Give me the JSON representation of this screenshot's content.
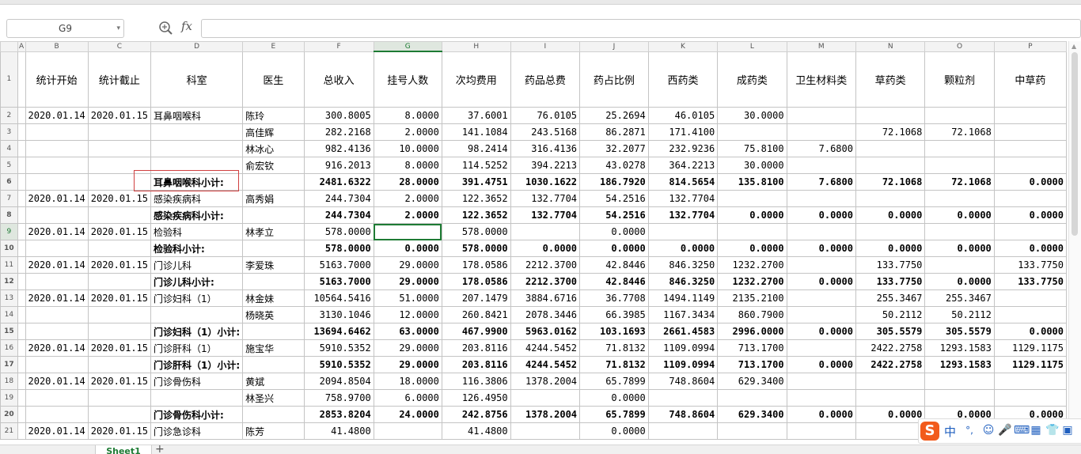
{
  "formula_bar": {
    "cell_ref": "G9",
    "fx_label": "fx",
    "formula": ""
  },
  "columns": [
    "A",
    "B",
    "C",
    "D",
    "E",
    "F",
    "G",
    "H",
    "I",
    "J",
    "K",
    "L",
    "M",
    "N",
    "O",
    "P"
  ],
  "header": [
    "统计开始",
    "统计截止",
    "科室",
    "医生",
    "总收入",
    "挂号人数",
    "次均费用",
    "药品总费",
    "药占比例",
    "西药类",
    "成药类",
    "卫生材料类",
    "草药类",
    "颗粒剂",
    "中草药"
  ],
  "rows": [
    {
      "num": "2",
      "type": "data",
      "cells": [
        "2020.01.14",
        "2020.01.15",
        "耳鼻咽喉科",
        "陈玲",
        "300.8005",
        "8.0000",
        "37.6001",
        "76.0105",
        "25.2694",
        "46.0105",
        "30.0000",
        "",
        "",
        "",
        ""
      ]
    },
    {
      "num": "3",
      "type": "data",
      "cells": [
        "",
        "",
        "",
        "高佳辉",
        "282.2168",
        "2.0000",
        "141.1084",
        "243.5168",
        "86.2871",
        "171.4100",
        "",
        "",
        "72.1068",
        "72.1068",
        ""
      ]
    },
    {
      "num": "4",
      "type": "data",
      "cells": [
        "",
        "",
        "",
        "林冰心",
        "982.4136",
        "10.0000",
        "98.2414",
        "316.4136",
        "32.2077",
        "232.9236",
        "75.8100",
        "7.6800",
        "",
        "",
        ""
      ]
    },
    {
      "num": "5",
      "type": "data",
      "cells": [
        "",
        "",
        "",
        "俞宏钦",
        "916.2013",
        "8.0000",
        "114.5252",
        "394.2213",
        "43.0278",
        "364.2213",
        "30.0000",
        "",
        "",
        "",
        ""
      ]
    },
    {
      "num": "6",
      "type": "sub",
      "cells": [
        "",
        "",
        "耳鼻咽喉科小计:",
        "",
        "2481.6322",
        "28.0000",
        "391.4751",
        "1030.1622",
        "186.7920",
        "814.5654",
        "135.8100",
        "7.6800",
        "72.1068",
        "72.1068",
        "0.0000"
      ]
    },
    {
      "num": "7",
      "type": "data",
      "cells": [
        "2020.01.14",
        "2020.01.15",
        "感染疾病科",
        "高秀娟",
        "244.7304",
        "2.0000",
        "122.3652",
        "132.7704",
        "54.2516",
        "132.7704",
        "",
        "",
        "",
        "",
        ""
      ]
    },
    {
      "num": "8",
      "type": "sub",
      "cells": [
        "",
        "",
        "感染疾病科小计:",
        "",
        "244.7304",
        "2.0000",
        "122.3652",
        "132.7704",
        "54.2516",
        "132.7704",
        "0.0000",
        "0.0000",
        "0.0000",
        "0.0000",
        "0.0000"
      ]
    },
    {
      "num": "9",
      "type": "data",
      "cells": [
        "2020.01.14",
        "2020.01.15",
        "检验科",
        "林孝立",
        "578.0000",
        "",
        "578.0000",
        "",
        "0.0000",
        "",
        "",
        "",
        "",
        "",
        ""
      ]
    },
    {
      "num": "10",
      "type": "sub",
      "cells": [
        "",
        "",
        "检验科小计:",
        "",
        "578.0000",
        "0.0000",
        "578.0000",
        "0.0000",
        "0.0000",
        "0.0000",
        "0.0000",
        "0.0000",
        "0.0000",
        "0.0000",
        "0.0000"
      ]
    },
    {
      "num": "11",
      "type": "data",
      "cells": [
        "2020.01.14",
        "2020.01.15",
        "门诊儿科",
        "李爱珠",
        "5163.7000",
        "29.0000",
        "178.0586",
        "2212.3700",
        "42.8446",
        "846.3250",
        "1232.2700",
        "",
        "133.7750",
        "",
        "133.7750"
      ]
    },
    {
      "num": "12",
      "type": "sub",
      "cells": [
        "",
        "",
        "门诊儿科小计:",
        "",
        "5163.7000",
        "29.0000",
        "178.0586",
        "2212.3700",
        "42.8446",
        "846.3250",
        "1232.2700",
        "0.0000",
        "133.7750",
        "0.0000",
        "133.7750"
      ]
    },
    {
      "num": "13",
      "type": "data",
      "cells": [
        "2020.01.14",
        "2020.01.15",
        "门诊妇科（1）",
        "林金妹",
        "10564.5416",
        "51.0000",
        "207.1479",
        "3884.6716",
        "36.7708",
        "1494.1149",
        "2135.2100",
        "",
        "255.3467",
        "255.3467",
        ""
      ]
    },
    {
      "num": "14",
      "type": "data",
      "cells": [
        "",
        "",
        "",
        "杨晓英",
        "3130.1046",
        "12.0000",
        "260.8421",
        "2078.3446",
        "66.3985",
        "1167.3434",
        "860.7900",
        "",
        "50.2112",
        "50.2112",
        ""
      ]
    },
    {
      "num": "15",
      "type": "sub",
      "cells": [
        "",
        "",
        "门诊妇科（1）小计:",
        "",
        "13694.6462",
        "63.0000",
        "467.9900",
        "5963.0162",
        "103.1693",
        "2661.4583",
        "2996.0000",
        "0.0000",
        "305.5579",
        "305.5579",
        "0.0000"
      ]
    },
    {
      "num": "16",
      "type": "data",
      "cells": [
        "2020.01.14",
        "2020.01.15",
        "门诊肝科（1）",
        "施宝华",
        "5910.5352",
        "29.0000",
        "203.8116",
        "4244.5452",
        "71.8132",
        "1109.0994",
        "713.1700",
        "",
        "2422.2758",
        "1293.1583",
        "1129.1175"
      ]
    },
    {
      "num": "17",
      "type": "sub",
      "cells": [
        "",
        "",
        "门诊肝科（1）小计:",
        "",
        "5910.5352",
        "29.0000",
        "203.8116",
        "4244.5452",
        "71.8132",
        "1109.0994",
        "713.1700",
        "0.0000",
        "2422.2758",
        "1293.1583",
        "1129.1175"
      ]
    },
    {
      "num": "18",
      "type": "data",
      "cells": [
        "2020.01.14",
        "2020.01.15",
        "门诊骨伤科",
        "黄斌",
        "2094.8504",
        "18.0000",
        "116.3806",
        "1378.2004",
        "65.7899",
        "748.8604",
        "629.3400",
        "",
        "",
        "",
        ""
      ]
    },
    {
      "num": "19",
      "type": "data",
      "cells": [
        "",
        "",
        "",
        "林圣兴",
        "758.9700",
        "6.0000",
        "126.4950",
        "",
        "0.0000",
        "",
        "",
        "",
        "",
        "",
        ""
      ]
    },
    {
      "num": "20",
      "type": "sub",
      "cells": [
        "",
        "",
        "门诊骨伤科小计:",
        "",
        "2853.8204",
        "24.0000",
        "242.8756",
        "1378.2004",
        "65.7899",
        "748.8604",
        "629.3400",
        "0.0000",
        "0.0000",
        "0.0000",
        "0.0000"
      ]
    },
    {
      "num": "21",
      "type": "data",
      "cells": [
        "2020.01.14",
        "2020.01.15",
        "门诊急诊科",
        "陈芳",
        "41.4800",
        "",
        "41.4800",
        "",
        "0.0000",
        "",
        "",
        "",
        "",
        "",
        ""
      ]
    }
  ],
  "sheet_tab": "Sheet1",
  "add_sheet": "+",
  "ime": {
    "label": "中",
    "punct": "°,",
    "logo": "S"
  },
  "colors": {
    "accent": "#1e7b34",
    "grid": "#c4c4c4",
    "highlight_box": "#d04040"
  }
}
